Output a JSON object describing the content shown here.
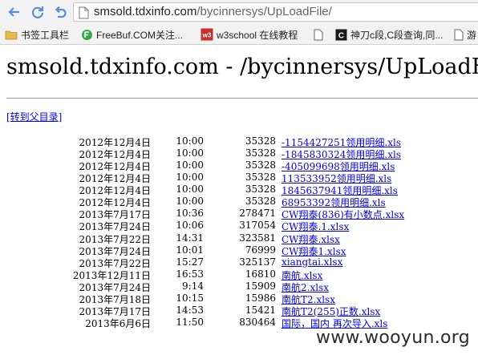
{
  "browser": {
    "url_host": "smsold.tdxinfo.com",
    "url_path": "/bycinnersys/UpLoadFile/",
    "bookmarks": [
      {
        "label": "书签工具栏",
        "icon": "folder-icon"
      },
      {
        "label": "FreeBuf.COM关注...",
        "icon": "freebuf-icon"
      },
      {
        "label": "w3school 在线教程",
        "icon": "w3school-icon"
      },
      {
        "label": "",
        "icon": "page-icon"
      },
      {
        "label": "神刀c段,C段查询,同...",
        "icon": "shendao-icon"
      },
      {
        "label": "游",
        "icon": "page-icon"
      }
    ]
  },
  "page": {
    "heading": "smsold.tdxinfo.com - /bycinnersys/UpLoadFile/",
    "parent_link": "[转到父目录]",
    "files": [
      {
        "date": "2012年12月4日",
        "time": "10:00",
        "size": "35328",
        "name": "-1154427251领用明细.xls"
      },
      {
        "date": "2012年12月4日",
        "time": "10:00",
        "size": "35328",
        "name": "-1845830324领用明细.xls"
      },
      {
        "date": "2012年12月4日",
        "time": "10:00",
        "size": "35328",
        "name": "-405099698领用明细.xls"
      },
      {
        "date": "2012年12月4日",
        "time": "10:00",
        "size": "35328",
        "name": "113533952领用明细.xls"
      },
      {
        "date": "2012年12月4日",
        "time": "10:00",
        "size": "35328",
        "name": "1845637941领用明细.xls"
      },
      {
        "date": "2012年12月4日",
        "time": "10:00",
        "size": "35328",
        "name": "68953392领用明细.xls"
      },
      {
        "date": "2013年7月17日",
        "time": "10:36",
        "size": "278471",
        "name": "CW翔泰(836)有小数点.xlsx"
      },
      {
        "date": "2013年7月24日",
        "time": "10:06",
        "size": "317054",
        "name": "CW翔泰.1.xlsx"
      },
      {
        "date": "2013年7月22日",
        "time": "14:31",
        "size": "323581",
        "name": "CW翔泰.xlsx"
      },
      {
        "date": "2013年7月24日",
        "time": "10:01",
        "size": "76999",
        "name": "CW翔泰1.xlsx"
      },
      {
        "date": "2013年7月22日",
        "time": "15:27",
        "size": "325137",
        "name": "xiangtai.xlsx"
      },
      {
        "date": "2013年12月11日",
        "time": "16:53",
        "size": "16810",
        "name": "南航.xlsx"
      },
      {
        "date": "2013年7月24日",
        "time": "9:14",
        "size": "15909",
        "name": "南航2.xlsx"
      },
      {
        "date": "2013年7月18日",
        "time": "10:15",
        "size": "15986",
        "name": "南航T2.xlsx"
      },
      {
        "date": "2013年7月17日",
        "time": "14:53",
        "size": "15421",
        "name": "南航T2(255)正数.xlsx"
      },
      {
        "date": "2013年6月6日",
        "time": "11:50",
        "size": "830464",
        "name": "国际，国内 再次导入.xls"
      }
    ]
  },
  "watermark": "www.wooyun.org"
}
